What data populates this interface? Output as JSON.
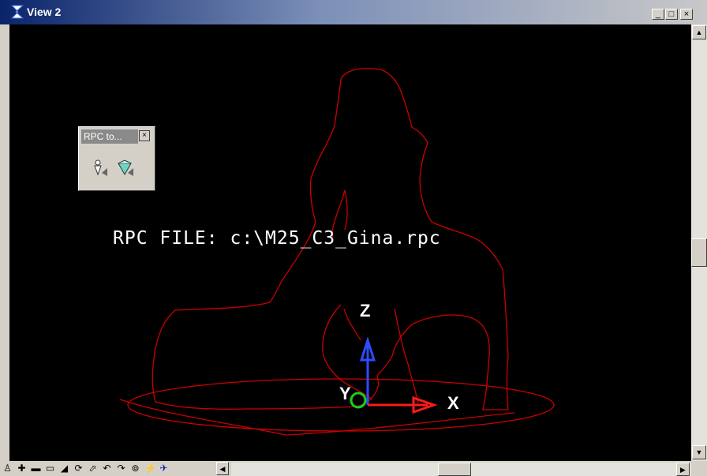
{
  "window": {
    "title": "View 2",
    "minimize_label": "_",
    "maximize_label": "□",
    "close_label": "×"
  },
  "toolbox": {
    "title": "RPC to...",
    "close_label": "×",
    "tools": [
      "rpc-place-icon",
      "rpc-edit-icon"
    ]
  },
  "viewport": {
    "rpc_label": "RPC FILE: c:\\M25_C3_Gina.rpc",
    "axis_x_label": "X",
    "axis_y_label": "Y",
    "axis_z_label": "Z",
    "background_color": "#000000",
    "outline_color": "#cc0000"
  },
  "view_controls": [
    "update-view-icon",
    "zoom-in-icon",
    "zoom-out-icon",
    "window-area-icon",
    "fit-view-icon",
    "rotate-view-icon",
    "pan-view-icon",
    "view-previous-icon",
    "view-next-icon",
    "copy-view-icon",
    "camera-icon",
    "navigate-icon"
  ]
}
